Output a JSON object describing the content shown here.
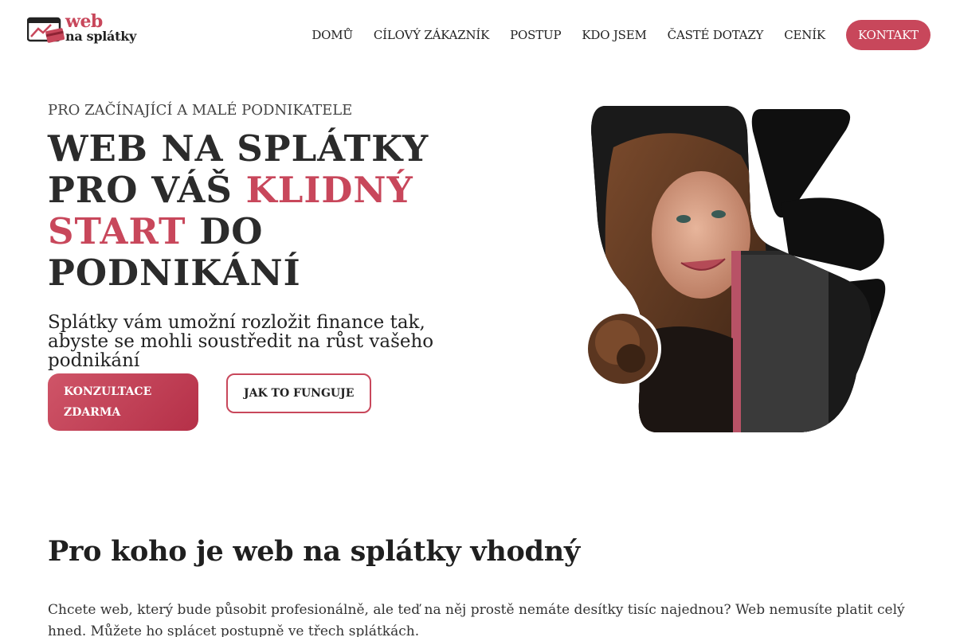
{
  "brand": {
    "line1": "web",
    "line2": "na splátky",
    "accent": "#c8475b"
  },
  "nav": {
    "items": [
      "DOMŮ",
      "CÍLOVÝ ZÁKAZNÍK",
      "POSTUP",
      "KDO JSEM",
      "ČASTÉ DOTAZY",
      "CENÍK"
    ],
    "contact": "KONTAKT"
  },
  "hero": {
    "eyebrow": "PRO ZAČÍNAJÍCÍ A MALÉ PODNIKATELE",
    "headline_1": "WEB NA SPLÁTKY PRO VÁŠ ",
    "headline_accent": "KLIDNÝ START",
    "headline_2": " DO PODNIKÁNÍ",
    "subline": "Splátky vám umožní rozložit finance tak, abyste se mohli soustředit na růst vašeho podnikání",
    "cta_primary": "KONZULTACE ZDARMA",
    "cta_secondary": "JAK TO FUNGUJE",
    "photo_icon": "portrait-photo"
  },
  "section": {
    "title": "Pro koho je web na splátky vhodný",
    "body": "Chcete web, který bude působit profesionálně, ale teď na něj prostě nemáte desítky tisíc najednou? Web nemusíte platit celý hned. Můžete ho splácet postupně ve třech splátkách."
  }
}
